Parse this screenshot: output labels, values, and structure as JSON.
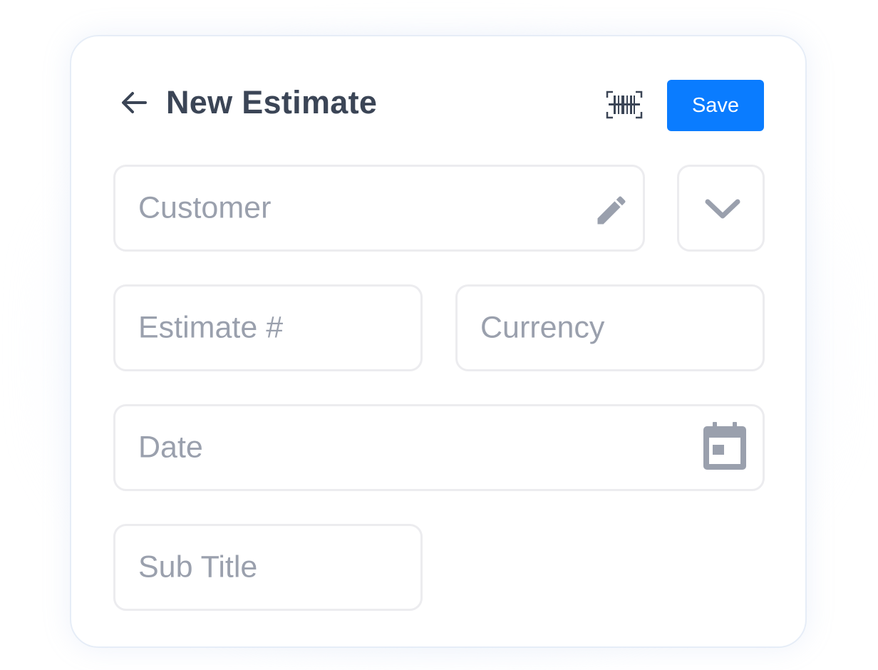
{
  "header": {
    "title": "New Estimate",
    "save_label": "Save"
  },
  "form": {
    "customer": {
      "placeholder": "Customer",
      "icon": "pencil-icon"
    },
    "customer_dropdown": {
      "icon": "chevron-down-icon"
    },
    "estimate_number": {
      "placeholder": "Estimate #"
    },
    "currency": {
      "placeholder": "Currency"
    },
    "date": {
      "placeholder": "Date",
      "icon": "calendar-icon"
    },
    "sub_title": {
      "placeholder": "Sub Title"
    }
  },
  "colors": {
    "accent": "#0a7cff",
    "title": "#3b4556",
    "placeholder": "#9aa0ad",
    "icon": "#9aa0ad",
    "field_border": "#ececef"
  }
}
